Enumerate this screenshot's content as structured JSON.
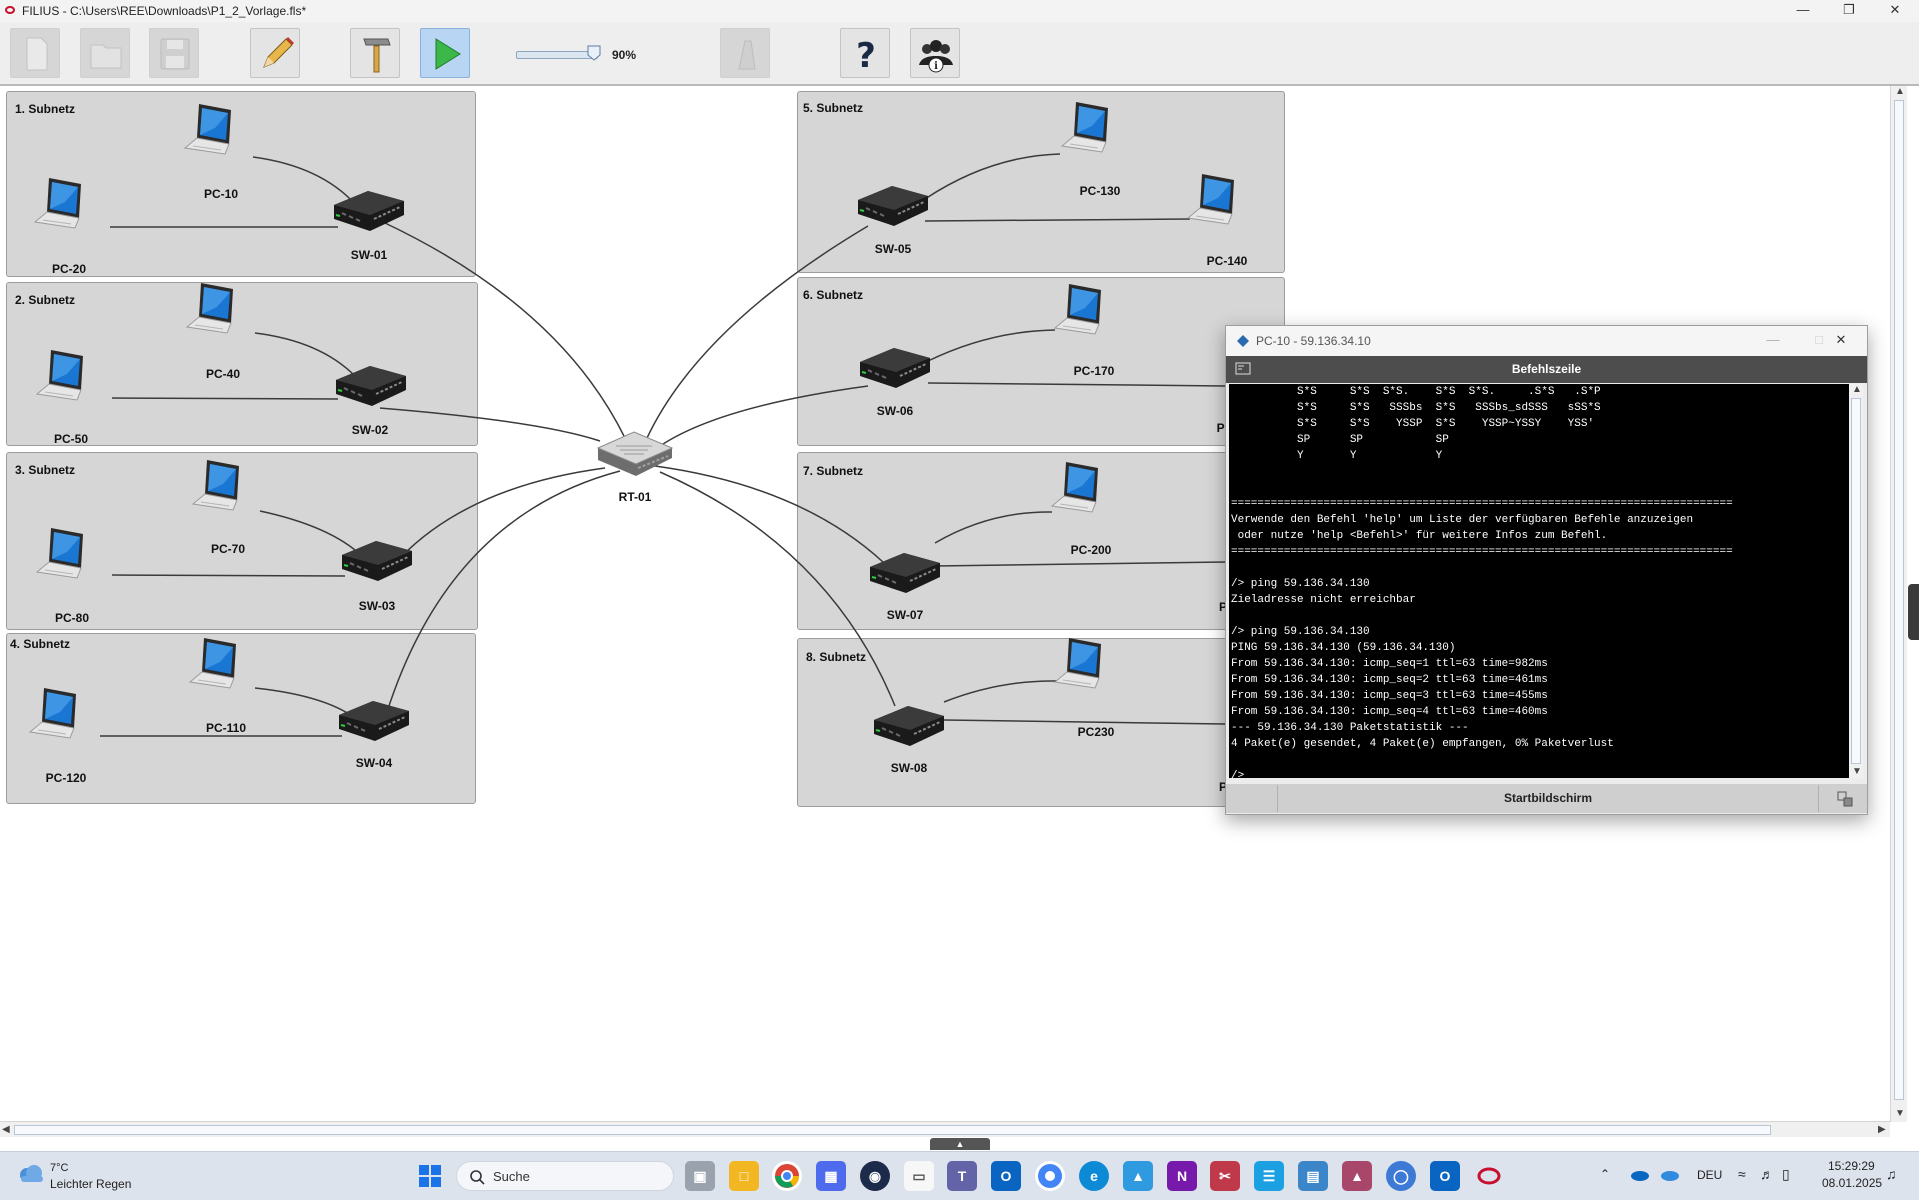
{
  "window": {
    "title": "FILIUS - C:\\Users\\REE\\Downloads\\P1_2_Vorlage.fls*",
    "controls": [
      "minimize",
      "maximize",
      "close"
    ]
  },
  "toolbar": {
    "buttons": [
      {
        "name": "new-file",
        "icon": "new-file-icon",
        "enabled": false
      },
      {
        "name": "open-file",
        "icon": "open-folder-icon",
        "enabled": false
      },
      {
        "name": "save-file",
        "icon": "floppy-disk-icon",
        "enabled": false
      },
      {
        "name": "design-mode",
        "icon": "pencil-icon",
        "enabled": true
      },
      {
        "name": "build-mode",
        "icon": "hammer-icon",
        "enabled": true
      },
      {
        "name": "simulation-mode",
        "icon": "play-icon",
        "enabled": true,
        "active": true
      },
      {
        "name": "record",
        "icon": "recorder-icon",
        "enabled": false
      },
      {
        "name": "help",
        "icon": "question-mark-icon",
        "enabled": true
      },
      {
        "name": "info",
        "icon": "people-info-icon",
        "enabled": true
      }
    ],
    "zoom": {
      "value": 90,
      "label": "90%"
    }
  },
  "network": {
    "subnets": [
      {
        "label": "1. Subnetz"
      },
      {
        "label": "2. Subnetz"
      },
      {
        "label": "3. Subnetz"
      },
      {
        "label": "4. Subnetz"
      },
      {
        "label": "5. Subnetz"
      },
      {
        "label": "6. Subnetz"
      },
      {
        "label": "7. Subnetz"
      },
      {
        "label": "8. Subnetz"
      }
    ],
    "router": {
      "label": "RT-01"
    },
    "switches": [
      "SW-01",
      "SW-02",
      "SW-03",
      "SW-04",
      "SW-05",
      "SW-06",
      "SW-07",
      "SW-08"
    ],
    "pcs": [
      "PC-10",
      "PC-20",
      "PC-40",
      "PC-50",
      "PC-70",
      "PC-80",
      "PC-110",
      "PC-120",
      "PC-130",
      "PC-140",
      "PC-170",
      "PC-200",
      "PC230"
    ],
    "partially_hidden_labels": [
      "PC-",
      "P",
      "P"
    ]
  },
  "terminal": {
    "window_title": "PC-10 - 59.136.34.10",
    "header": "Befehlszeile",
    "lines": [
      "          S*S     S*S  S*S.    S*S  S*S.     .S*S   .S*P",
      "          S*S     S*S   SSSbs  S*S   SSSbs_sdSSS   sSS*S",
      "          S*S     S*S    YSSP  S*S    YSSP~YSSY    YSS'",
      "          SP      SP           SP",
      "          Y       Y            Y",
      "",
      "",
      "============================================================================",
      "Verwende den Befehl 'help' um Liste der verfügbaren Befehle anzuzeigen",
      " oder nutze 'help <Befehl>' für weitere Infos zum Befehl.",
      "============================================================================",
      "",
      "/> ping 59.136.34.130",
      "Zieladresse nicht erreichbar",
      "",
      "/> ping 59.136.34.130",
      "PING 59.136.34.130 (59.136.34.130)",
      "From 59.136.34.130: icmp_seq=1 ttl=63 time=982ms",
      "From 59.136.34.130: icmp_seq=2 ttl=63 time=461ms",
      "From 59.136.34.130: icmp_seq=3 ttl=63 time=455ms",
      "From 59.136.34.130: icmp_seq=4 ttl=63 time=460ms",
      "--- 59.136.34.130 Paketstatistik ---",
      "4 Paket(e) gesendet, 4 Paket(e) empfangen, 0% Paketverlust",
      "",
      "/>"
    ],
    "footer_button": "Startbildschirm"
  },
  "taskbar": {
    "weather": {
      "temp": "7°C",
      "desc": "Leichter Regen"
    },
    "search_placeholder": "Suche",
    "language": "DEU",
    "time": "15:29:29",
    "date": "08.01.2025",
    "apps": [
      "start-icon",
      "task-view-icon",
      "file-explorer-icon",
      "chrome-icon",
      "store-icon",
      "lock-app-icon",
      "notepad-icon",
      "teams-icon",
      "outlook-icon",
      "chrome-alt-icon",
      "edge-icon",
      "photos-icon",
      "onenote-icon",
      "snipping-icon",
      "notes-icon",
      "remote-desktop-icon",
      "filius-task-icon",
      "browser-circle-icon",
      "outlook-new-icon",
      "filius-red-icon"
    ]
  },
  "colors": {
    "subnet_bg": "#d6d6d6",
    "terminal_bg": "#000000",
    "terminal_text": "#ffffff",
    "terminal_header": "#4d4d4d",
    "play_active": "#b8d6f4"
  }
}
